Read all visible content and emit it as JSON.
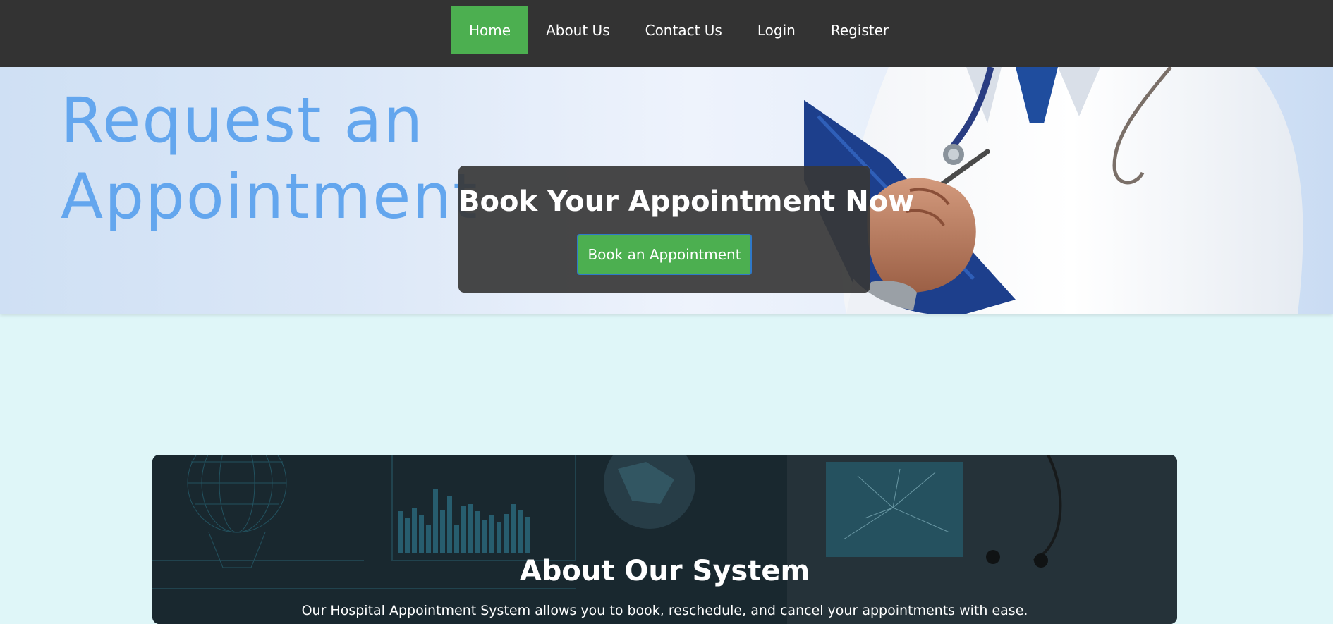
{
  "nav": {
    "items": [
      {
        "label": "Home",
        "active": true
      },
      {
        "label": "About Us",
        "active": false
      },
      {
        "label": "Contact Us",
        "active": false
      },
      {
        "label": "Login",
        "active": false
      },
      {
        "label": "Register",
        "active": false
      }
    ]
  },
  "hero": {
    "background_text_line1": "Request an",
    "background_text_line2": "Appointment",
    "card_title": "Book Your Appointment Now",
    "button_label": "Book an Appointment"
  },
  "about": {
    "title": "About Our System",
    "text": "Our Hospital Appointment System allows you to book, reschedule, and cancel your appointments with ease."
  },
  "colors": {
    "navbar": "#333333",
    "active_nav": "#4caf50",
    "page_background": "#dff6f8",
    "hero_text": "#63a6ee"
  }
}
